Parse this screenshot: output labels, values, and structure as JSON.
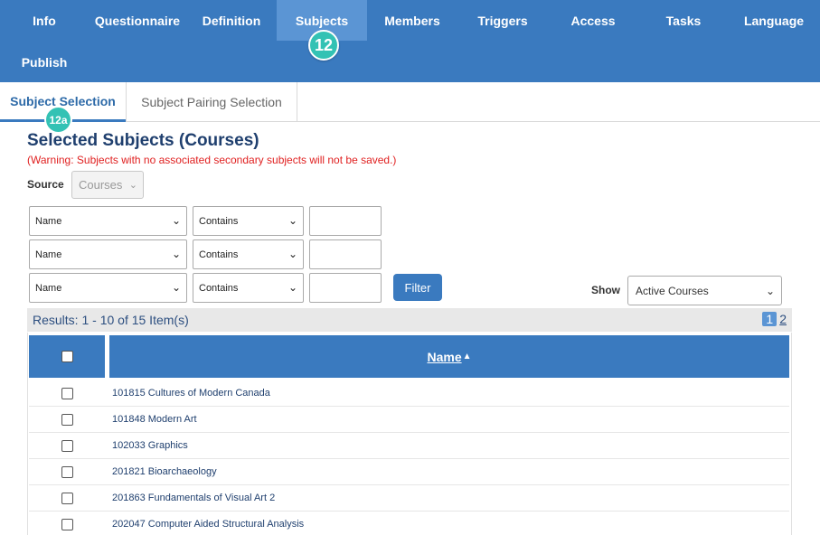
{
  "nav": {
    "items": [
      "Info",
      "Questionnaire",
      "Definition",
      "Subjects",
      "Members",
      "Triggers",
      "Access",
      "Tasks",
      "Language",
      "Publish"
    ],
    "active": "Subjects",
    "badge": "12"
  },
  "subtabs": {
    "items": [
      "Subject Selection",
      "Subject Pairing Selection"
    ],
    "badge": "12a"
  },
  "heading": "Selected Subjects (Courses)",
  "warning": "(Warning: Subjects with no associated secondary subjects will not be saved.)",
  "source": {
    "label": "Source",
    "value": "Courses"
  },
  "filters": [
    {
      "field": "Name",
      "operator": "Contains",
      "value": ""
    },
    {
      "field": "Name",
      "operator": "Contains",
      "value": ""
    },
    {
      "field": "Name",
      "operator": "Contains",
      "value": ""
    }
  ],
  "filter_button": "Filter",
  "show": {
    "label": "Show",
    "value": "Active Courses"
  },
  "results": {
    "summary": "Results: 1 - 10 of 15 Item(s)",
    "pages": [
      "1",
      "2"
    ],
    "current_page": "1"
  },
  "grid": {
    "column_name": "Name",
    "sort_icon": "▲",
    "rows": [
      "101815 Cultures of Modern Canada",
      "101848 Modern Art",
      "102033 Graphics",
      "201821 Bioarchaeology",
      "201863 Fundamentals of Visual Art 2",
      "202047 Computer Aided Structural Analysis"
    ]
  },
  "colors": {
    "primary": "#3a7abf",
    "active_tab": "#5b95d4",
    "badge": "#33c2b4",
    "warning": "#e02020"
  }
}
